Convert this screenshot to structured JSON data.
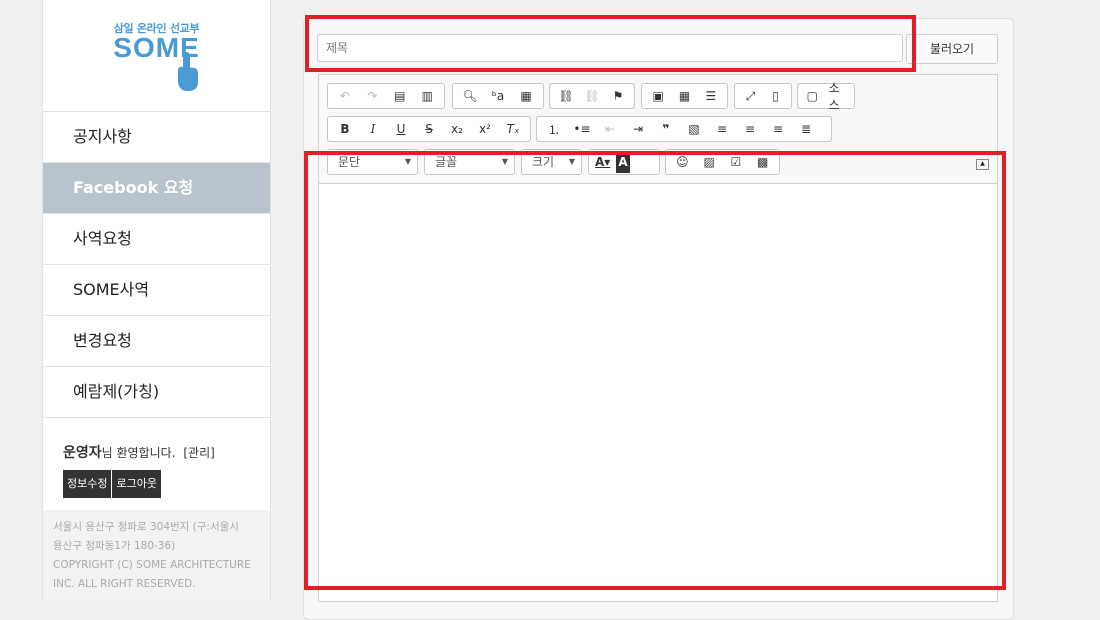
{
  "logo": {
    "subtitle": "삼일 온라인 선교부",
    "name": "SOME"
  },
  "sidebar": {
    "items": [
      {
        "label": "공지사항",
        "active": false
      },
      {
        "label": "Facebook 요청",
        "active": true
      },
      {
        "label": "사역요청",
        "active": false
      },
      {
        "label": "SOME사역",
        "active": false
      },
      {
        "label": "변경요청",
        "active": false
      },
      {
        "label": "예람제(가칭)",
        "active": false
      }
    ],
    "welcome_name": "운영자",
    "welcome_text": "님 환영합니다.",
    "admin_link": "[관리]",
    "edit_info_button": "정보수정",
    "logout_button": "로그아웃",
    "footer_lines": [
      "서울시 용산구 청파로 304번지 (구:서울시",
      "용산구 청파동1가 180-36)",
      "COPYRIGHT (C) SOME ARCHITECTURE",
      "INC. ALL RIGHT RESERVED."
    ]
  },
  "form": {
    "title_placeholder": "제목",
    "load_button": "불러오기"
  },
  "editor": {
    "source_label": "소스",
    "format_combo": "문단",
    "font_combo": "글꼴",
    "size_combo": "크기"
  },
  "colors": {
    "highlight": "#e21f26",
    "active_menu": "#b9c3cd",
    "brand": "#4a9ad4"
  }
}
